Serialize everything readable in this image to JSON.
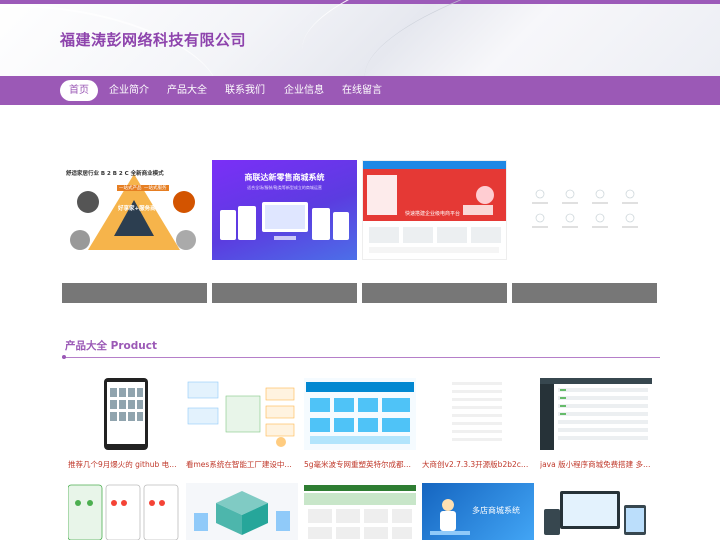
{
  "header": {
    "company_name": "福建涛彭网络科技有限公司"
  },
  "nav": {
    "items": [
      "首页",
      "企业简介",
      "产品大全",
      "联系我们",
      "企业信息",
      "在线留言"
    ],
    "active_index": 0
  },
  "banners": {
    "b1": {
      "title": "舒适家居行业 B 2 B 2 C 全新商业模式",
      "center": "好享家+服务商",
      "tags": [
        "一站式产品",
        "一站式服务"
      ]
    },
    "b2": {
      "title": "商联达新零售商城系统",
      "subtitle": "适合全场/服装/鞋类等新型成立的商城运营"
    },
    "b3": {
      "headline": "快速搭建企业级电商平台"
    }
  },
  "section": {
    "title": "产品大全 Product"
  },
  "products": [
    "推荐几个9月爆火的 github 电商项目",
    "看mes系统在智能工厂建设中的位置",
    "5g毫米波专网重塑英特尔成都工厂...",
    "大商创v2.7.3.3开源版b2b2c多用...",
    "java 版小程序商城免费搭建 多商..."
  ],
  "row2": {
    "card4_label": "多店商城系统"
  },
  "colors": {
    "brand": "#9b59b6",
    "title_red": "#c0392b",
    "banner_purple": "#6d3ce8",
    "banner_red": "#e53935"
  }
}
